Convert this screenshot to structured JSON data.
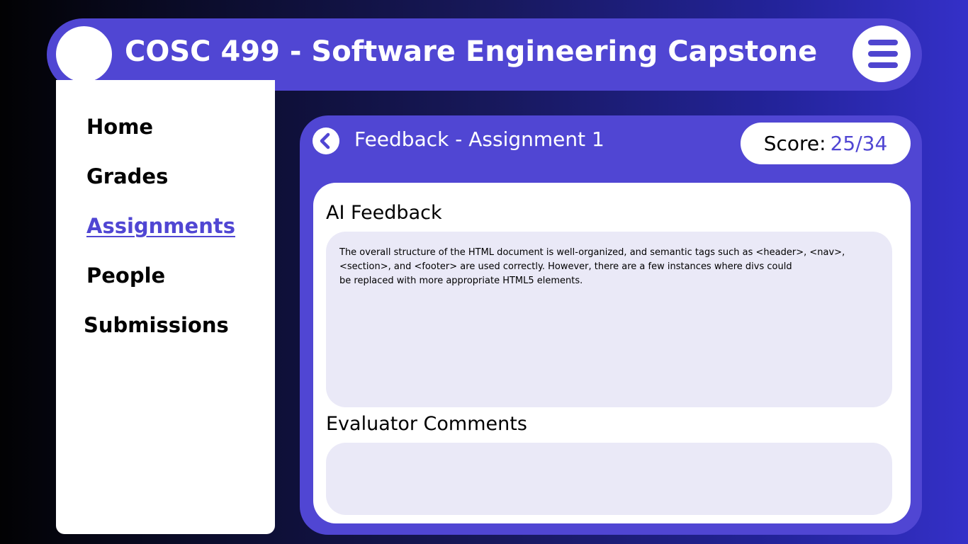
{
  "header": {
    "course_title": "COSC 499 - Software Engineering Capstone"
  },
  "sidebar": {
    "items": [
      {
        "label": "Home",
        "active": false
      },
      {
        "label": "Grades",
        "active": false
      },
      {
        "label": "Assignments",
        "active": true
      },
      {
        "label": "People",
        "active": false
      },
      {
        "label": "Submissions",
        "active": false
      }
    ]
  },
  "main": {
    "title": "Feedback - Assignment 1",
    "score_label": "Score:",
    "score_value": "25/34",
    "ai_feedback_heading": "AI Feedback",
    "ai_feedback_text": "The overall structure of the HTML document is well-organized, and semantic tags such as <header>, <nav>,\n<section>, and <footer> are used correctly. However, there are a few instances where divs could\nbe replaced with more appropriate HTML5 elements.",
    "evaluator_heading": "Evaluator Comments",
    "evaluator_text": ""
  },
  "icons": {
    "menu": "hamburger-menu-icon",
    "back": "chevron-left-icon",
    "avatar": "avatar-icon"
  },
  "colors": {
    "accent": "#5046d3",
    "box_fill": "#eae9f7",
    "text_on_accent": "#ffffff"
  }
}
